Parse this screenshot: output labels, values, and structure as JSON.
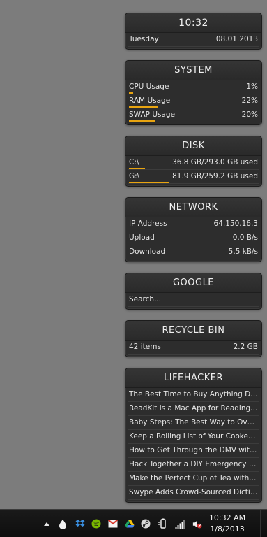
{
  "clock_widget": {
    "time": "10:32",
    "day": "Tuesday",
    "date": "08.01.2013"
  },
  "system": {
    "title": "SYSTEM",
    "rows": [
      {
        "label": "CPU Usage",
        "value": "1%",
        "percent": 1
      },
      {
        "label": "RAM Usage",
        "value": "22%",
        "percent": 22
      },
      {
        "label": "SWAP Usage",
        "value": "20%",
        "percent": 20
      }
    ]
  },
  "disk": {
    "title": "DISK",
    "rows": [
      {
        "label": "C:\\",
        "value": "36.8 GB/293.0 GB used",
        "percent": 12.6
      },
      {
        "label": "G:\\",
        "value": "81.9 GB/259.2 GB used",
        "percent": 31.6
      }
    ]
  },
  "network": {
    "title": "NETWORK",
    "rows": [
      {
        "label": "IP Address",
        "value": "64.150.16.3"
      },
      {
        "label": "Upload",
        "value": "0.0 B/s"
      },
      {
        "label": "Download",
        "value": "5.5 kB/s"
      }
    ]
  },
  "google": {
    "title": "GOOGLE",
    "search_placeholder": "Search..."
  },
  "recycle_bin": {
    "title": "RECYCLE BIN",
    "items": "42 items",
    "size": "2.2 GB"
  },
  "lifehacker": {
    "title": "LIFEHACKER",
    "links": [
      "The Best Time to Buy Anything Du...",
      "ReadKit Is a Mac App for Reading I...",
      "Baby Steps: The Best Way to Over...",
      "Keep a Rolling List of Your Cooked...",
      "How to Get Through the DMV with...",
      "Hack Together a DIY Emergency Ca...",
      "Make the Perfect Cup of Tea with...",
      "Swype Adds Crowd-Sourced Dictio..."
    ]
  },
  "taskbar": {
    "time": "10:32 AM",
    "date": "1/8/2013",
    "icons": [
      "show-hidden-icons-arrow",
      "water-drop-icon",
      "dropbox-icon",
      "spotify-icon",
      "gmail-icon",
      "google-drive-icon",
      "steam-icon",
      "power-plug-icon",
      "network-signal-icon",
      "volume-muted-icon"
    ]
  },
  "colors": {
    "background": "#7c7c7c",
    "widget_bg": "#2d2d2d",
    "bar": "#e8a410"
  }
}
